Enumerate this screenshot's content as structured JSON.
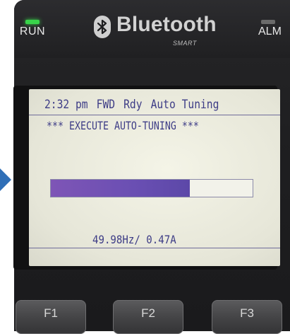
{
  "indicators": {
    "run_label": "RUN",
    "alm_label": "ALM"
  },
  "brand": {
    "name": "Bluetooth",
    "tagline": "SMART",
    "icon": "bluetooth-icon"
  },
  "screen": {
    "status": {
      "time": "2:32 pm",
      "direction": "FWD",
      "state": "Rdy",
      "mode": "Auto Tuning"
    },
    "title": "*** EXECUTE AUTO-TUNING ***",
    "progress": 0.69,
    "reading": "49.98Hz/  0.47A"
  },
  "function_keys": [
    "F1",
    "F2",
    "F3"
  ],
  "colors": {
    "lcd_text": "#3d3c86",
    "progress_fill": "#7e55b6",
    "run_led": "#39d44a"
  }
}
